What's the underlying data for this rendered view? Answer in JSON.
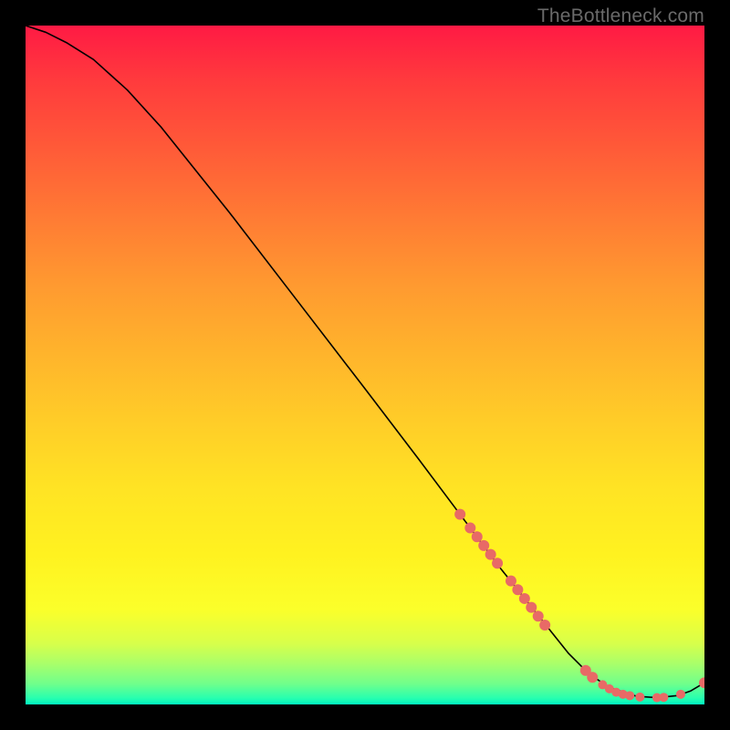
{
  "watermark": "TheBottleneck.com",
  "chart_data": {
    "type": "line",
    "title": "",
    "xlabel": "",
    "ylabel": "",
    "xlim": [
      0,
      100
    ],
    "ylim": [
      0,
      100
    ],
    "series": [
      {
        "name": "curve",
        "x": [
          0,
          3,
          6,
          10,
          15,
          20,
          30,
          40,
          50,
          58,
          64,
          70,
          76,
          80,
          83,
          86,
          90,
          93,
          96,
          98,
          100
        ],
        "y": [
          100,
          99,
          97.5,
          95,
          90.5,
          85,
          72.5,
          59.5,
          46.5,
          36,
          28,
          20,
          12.5,
          7.5,
          4.5,
          2.5,
          1.2,
          1,
          1.3,
          2,
          3.2
        ]
      }
    ],
    "markers": {
      "name": "highlighted-points",
      "color": "#e86a66",
      "points": [
        {
          "x": 64.0,
          "y": 28.0,
          "r": 6
        },
        {
          "x": 65.5,
          "y": 26.0,
          "r": 6
        },
        {
          "x": 66.5,
          "y": 24.7,
          "r": 6
        },
        {
          "x": 67.5,
          "y": 23.4,
          "r": 6
        },
        {
          "x": 68.5,
          "y": 22.1,
          "r": 6
        },
        {
          "x": 69.5,
          "y": 20.8,
          "r": 6
        },
        {
          "x": 71.5,
          "y": 18.2,
          "r": 6
        },
        {
          "x": 72.5,
          "y": 16.9,
          "r": 6
        },
        {
          "x": 73.5,
          "y": 15.6,
          "r": 6
        },
        {
          "x": 74.5,
          "y": 14.3,
          "r": 6
        },
        {
          "x": 75.5,
          "y": 13.0,
          "r": 6
        },
        {
          "x": 76.5,
          "y": 11.7,
          "r": 6
        },
        {
          "x": 82.5,
          "y": 5.0,
          "r": 6
        },
        {
          "x": 83.5,
          "y": 4.0,
          "r": 6
        },
        {
          "x": 85.0,
          "y": 2.9,
          "r": 5
        },
        {
          "x": 86.0,
          "y": 2.3,
          "r": 5
        },
        {
          "x": 87.0,
          "y": 1.8,
          "r": 5
        },
        {
          "x": 88.0,
          "y": 1.5,
          "r": 5
        },
        {
          "x": 89.0,
          "y": 1.3,
          "r": 5
        },
        {
          "x": 90.5,
          "y": 1.1,
          "r": 5
        },
        {
          "x": 93.0,
          "y": 1.0,
          "r": 5
        },
        {
          "x": 94.0,
          "y": 1.05,
          "r": 5
        },
        {
          "x": 96.5,
          "y": 1.5,
          "r": 5
        },
        {
          "x": 100.0,
          "y": 3.2,
          "r": 6
        }
      ]
    }
  }
}
